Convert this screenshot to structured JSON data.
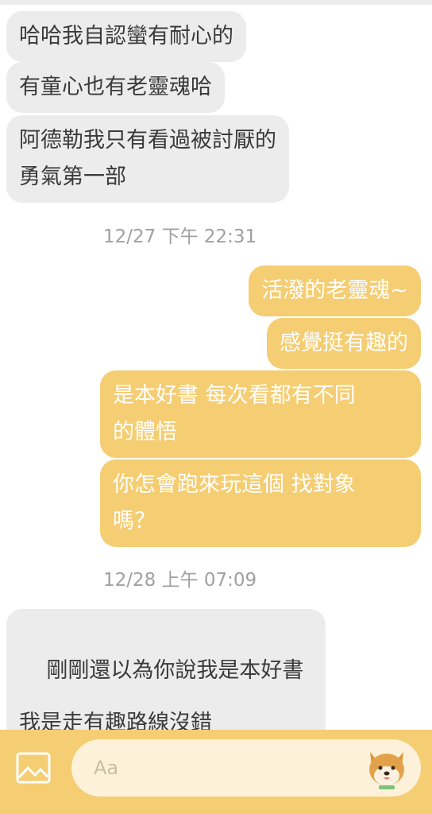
{
  "messages": [
    {
      "text": "哈哈我自認蠻有耐心的"
    },
    {
      "text": "有童心也有老靈魂哈"
    },
    {
      "text": "阿德勒我只有看過被討厭的\n勇氣第一部"
    },
    {
      "timestamp": "12/27 下午 22:31"
    },
    {
      "text": "活潑的老靈魂~"
    },
    {
      "text": "感覺挺有趣的"
    },
    {
      "text": "是本好書 每次看都有不同\n的體悟"
    },
    {
      "text": "你怎會跑來玩這個 找對象\n嗎？"
    },
    {
      "timestamp": "12/28 上午 07:09"
    },
    {
      "text": "剛剛還以為你說我是本好書",
      "emoji": "rolling-laughing-emoji"
    },
    {
      "text": "我是走有趣路線沒錯"
    }
  ],
  "composer": {
    "placeholder": "Aa",
    "image_icon": "image-icon",
    "sticker_icon": "shiba-sticker-icon"
  },
  "colors": {
    "incoming": "#ececec",
    "outgoing": "#f5cd72",
    "bar": "#f5cd72"
  }
}
